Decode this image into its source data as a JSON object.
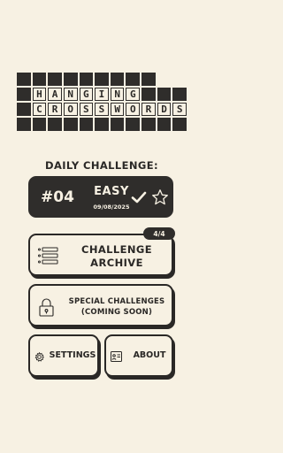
{
  "logo": {
    "grid": [
      "#########  ",
      "#HANGING###",
      "#CROSSWORDS",
      "###########"
    ]
  },
  "daily": {
    "label": "DAILY CHALLENGE:",
    "number": "#04",
    "difficulty": "EASY",
    "date": "09/08/2025",
    "completed": true,
    "starred": false
  },
  "archive": {
    "label": "CHALLENGE ARCHIVE",
    "badge": "4/4"
  },
  "special": {
    "label": "SPECIAL CHALLENGES (COMING SOON)",
    "locked": true
  },
  "settings": {
    "label": "SETTINGS"
  },
  "about": {
    "label": "ABOUT"
  }
}
